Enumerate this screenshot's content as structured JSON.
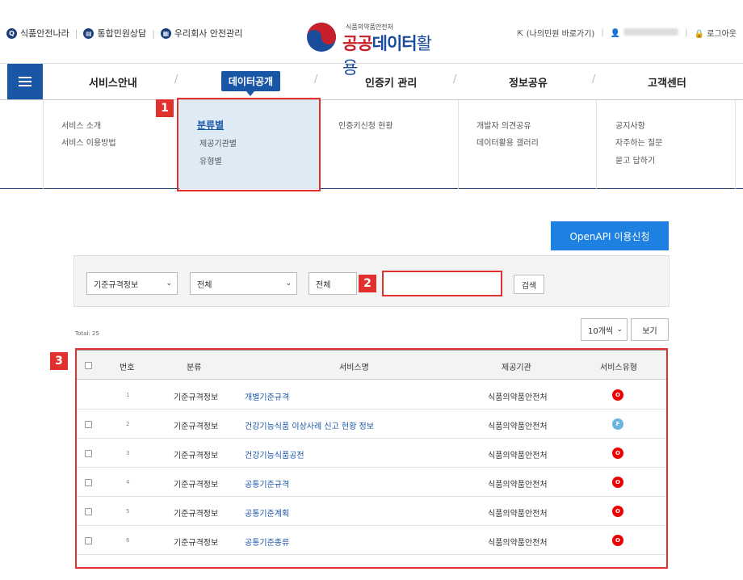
{
  "top_util": {
    "links": [
      "식품안전나라",
      "통합민원상담",
      "우리회사 안전관리"
    ],
    "logo_sub": "식품의약품안전처",
    "logo_main_part1": "공공",
    "logo_main_part2": "데이터",
    "logo_main_part3": "활용",
    "my_page": "(나의민원 바로가기)",
    "logout": "로그아웃"
  },
  "nav": {
    "items": [
      "서비스안내",
      "데이터공개",
      "인증키 관리",
      "정보공유",
      "고객센터"
    ],
    "active": "데이터공개"
  },
  "mega_menu": {
    "col1": [
      "서비스 소개",
      "서비스 이용방법"
    ],
    "col2_strong": "분류별",
    "col2": [
      "제공기관별",
      "유형별"
    ],
    "col3": [
      "인증키신청 현황"
    ],
    "col4": [
      "개발자 의견공유",
      "데이터활용 갤러리"
    ],
    "col5": [
      "공지사항",
      "자주하는 질문",
      "묻고 답하기"
    ]
  },
  "annotations": [
    "1",
    "2",
    "3"
  ],
  "openapi_button": "OpenAPI 이용신청",
  "search": {
    "select1": "기준규격정보",
    "select2": "전체",
    "select3": "전체",
    "search_button": "검색"
  },
  "total": "Total: 25",
  "per_page": "10개씩",
  "view_button": "보기",
  "table": {
    "headers": [
      "번호",
      "분류",
      "서비스명",
      "제공기관",
      "서비스유형"
    ],
    "rows": [
      {
        "no": "1",
        "category": "기준규격정보",
        "name": "개별기준규격",
        "org": "식품의약품안전처",
        "type": "O"
      },
      {
        "no": "2",
        "category": "기준규격정보",
        "name": "건강기능식품 이상사례 신고 현황 정보",
        "org": "식품의약품안전처",
        "type": "F"
      },
      {
        "no": "3",
        "category": "기준규격정보",
        "name": "건강기능식품공전",
        "org": "식품의약품안전처",
        "type": "O"
      },
      {
        "no": "4",
        "category": "기준규격정보",
        "name": "공통기준규격",
        "org": "식품의약품안전처",
        "type": "O"
      },
      {
        "no": "5",
        "category": "기준규격정보",
        "name": "공통기준계획",
        "org": "식품의약품안전처",
        "type": "O"
      },
      {
        "no": "6",
        "category": "기준규격정보",
        "name": "공통기준종류",
        "org": "식품의약품안전처",
        "type": "O"
      }
    ]
  },
  "colors": {
    "primary": "#1a56a6",
    "annotation_red": "#e0312f",
    "openapi_blue": "#1e80e0"
  }
}
